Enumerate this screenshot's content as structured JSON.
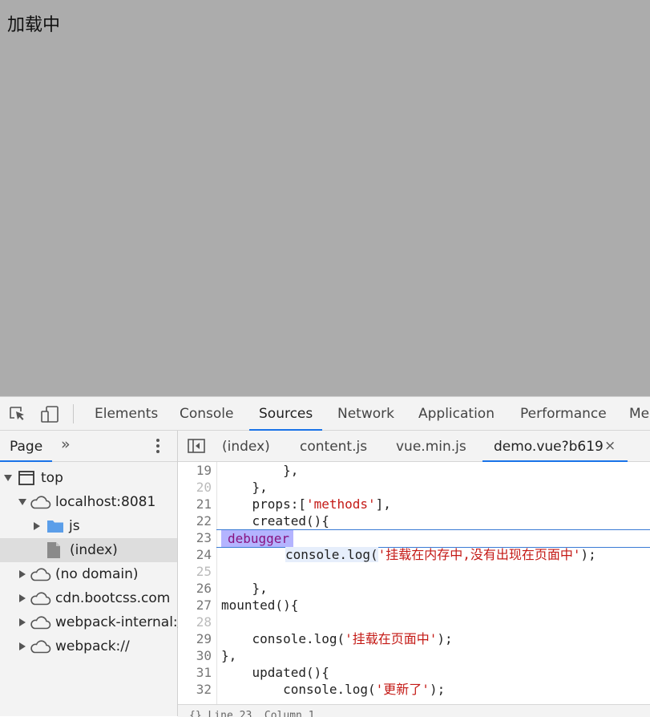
{
  "page": {
    "loading_text": "加载中"
  },
  "devtools": {
    "main_tabs": [
      "Elements",
      "Console",
      "Sources",
      "Network",
      "Application",
      "Performance",
      "Mer"
    ],
    "active_main_tab": "Sources",
    "navigator": {
      "tab": "Page",
      "more": "»",
      "tree": [
        {
          "label": "top",
          "icon": "frame-icon",
          "expanded": true
        },
        {
          "label": "localhost:8081",
          "icon": "cloud-icon",
          "expanded": true
        },
        {
          "label": "js",
          "icon": "folder-icon",
          "expanded": false
        },
        {
          "label": "(index)",
          "icon": "file-icon",
          "selected": true
        },
        {
          "label": "(no domain)",
          "icon": "cloud-icon",
          "expanded": false
        },
        {
          "label": "cdn.bootcss.com",
          "icon": "cloud-icon",
          "expanded": false
        },
        {
          "label": "webpack-internal://",
          "icon": "cloud-icon",
          "expanded": false
        },
        {
          "label": "webpack://",
          "icon": "cloud-icon",
          "expanded": false
        }
      ]
    },
    "editor": {
      "tabs": [
        "(index)",
        "content.js",
        "vue.min.js",
        "demo.vue?b619"
      ],
      "active_tab": "demo.vue?b619",
      "close": "×",
      "lines": [
        {
          "num": "19",
          "pre": "        },",
          "str": "",
          "post": ""
        },
        {
          "num": "20",
          "pre": "    },",
          "str": "",
          "post": ""
        },
        {
          "num": "21",
          "pre": "    props:[",
          "str": "'methods'",
          "post": "],"
        },
        {
          "num": "22",
          "pre": "    created(){",
          "str": "",
          "post": ""
        },
        {
          "num": "23",
          "pre": "debugger",
          "str": "",
          "post": ""
        },
        {
          "num": "24",
          "pre": "console.log(",
          "str": "'挂载在内存中,没有出现在页面中'",
          "post": ");"
        },
        {
          "num": "25",
          "pre": "",
          "str": "",
          "post": ""
        },
        {
          "num": "26",
          "pre": "    },",
          "str": "",
          "post": ""
        },
        {
          "num": "27",
          "pre": "mounted(){",
          "str": "",
          "post": ""
        },
        {
          "num": "28",
          "pre": "",
          "str": "",
          "post": ""
        },
        {
          "num": "29",
          "pre": "    console.log(",
          "str": "'挂载在页面中'",
          "post": ");"
        },
        {
          "num": "30",
          "pre": "},",
          "str": "",
          "post": ""
        },
        {
          "num": "31",
          "pre": "    updated(){",
          "str": "",
          "post": ""
        },
        {
          "num": "32",
          "pre": "        console.log(",
          "str": "'更新了'",
          "post": ");"
        }
      ],
      "status": "{}   Line 23, Column 1"
    }
  },
  "colors": {
    "accent": "#1a73e8",
    "page_bg": "#acacac",
    "string": "#c41a16",
    "keyword": "#881280"
  }
}
